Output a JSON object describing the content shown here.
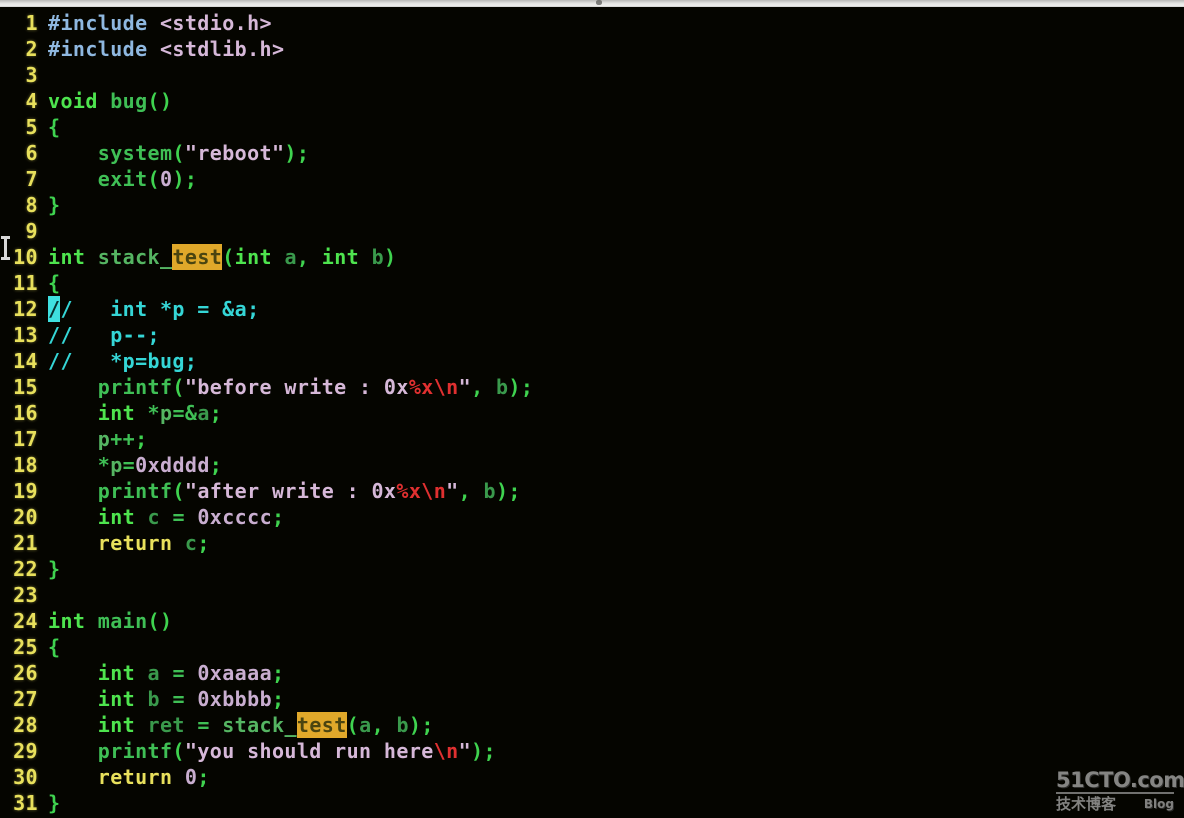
{
  "window": {
    "chrome_strip": "",
    "app": "vim",
    "background_color": "#050500",
    "accent_colors": {
      "line_number": "#e8e05c",
      "search_highlight_bg": "#e0a82a",
      "search_highlight_fg": "#4a4410",
      "cursor_bg": "#3fe0e0",
      "comment": "#35d6d6",
      "keyword": "#4ee44e",
      "string": "#d6b8d8",
      "escape": "#e03030",
      "number": "#c9aed0",
      "preproc": "#8fb8e0"
    }
  },
  "editor": {
    "language": "C",
    "search_term": "test",
    "cursor_line": 12,
    "cursor_column": 1,
    "first_visible_line": 1,
    "last_visible_line": 31,
    "lines": [
      {
        "n": "1",
        "text": "#include <stdio.h>"
      },
      {
        "n": "2",
        "text": "#include <stdlib.h>"
      },
      {
        "n": "3",
        "text": ""
      },
      {
        "n": "4",
        "text": "void bug()"
      },
      {
        "n": "5",
        "text": "{"
      },
      {
        "n": "6",
        "text": "    system(\"reboot\");"
      },
      {
        "n": "7",
        "text": "    exit(0);"
      },
      {
        "n": "8",
        "text": "}"
      },
      {
        "n": "9",
        "text": ""
      },
      {
        "n": "10",
        "text": "int stack_test(int a, int b)"
      },
      {
        "n": "11",
        "text": "{"
      },
      {
        "n": "12",
        "text": "//   int *p = &a;"
      },
      {
        "n": "13",
        "text": "//   p--;"
      },
      {
        "n": "14",
        "text": "//   *p=bug;"
      },
      {
        "n": "15",
        "text": "    printf(\"before write : 0x%x\\n\", b);"
      },
      {
        "n": "16",
        "text": "    int *p=&a;"
      },
      {
        "n": "17",
        "text": "    p++;"
      },
      {
        "n": "18",
        "text": "    *p=0xdddd;"
      },
      {
        "n": "19",
        "text": "    printf(\"after write : 0x%x\\n\", b);"
      },
      {
        "n": "20",
        "text": "    int c = 0xcccc;"
      },
      {
        "n": "21",
        "text": "    return c;"
      },
      {
        "n": "22",
        "text": "}"
      },
      {
        "n": "23",
        "text": ""
      },
      {
        "n": "24",
        "text": "int main()"
      },
      {
        "n": "25",
        "text": "{"
      },
      {
        "n": "26",
        "text": "    int a = 0xaaaa;"
      },
      {
        "n": "27",
        "text": "    int b = 0xbbbb;"
      },
      {
        "n": "28",
        "text": "    int ret = stack_test(a, b);"
      },
      {
        "n": "29",
        "text": "    printf(\"you should run here\\n\");"
      },
      {
        "n": "30",
        "text": "    return 0;"
      },
      {
        "n": "31",
        "text": "}"
      }
    ]
  },
  "watermark": {
    "main": "51CTO.com",
    "chinese": "技术博客",
    "blog": "Blog"
  }
}
